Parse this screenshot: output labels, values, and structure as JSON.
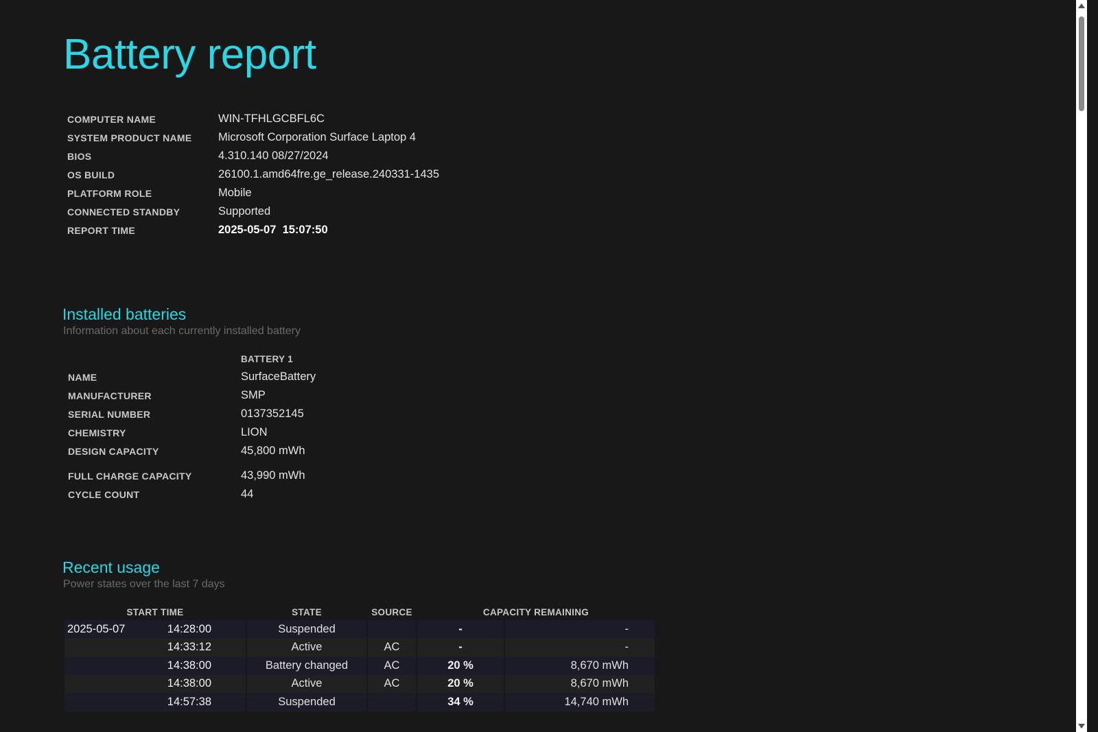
{
  "title": "Battery report",
  "system_info": [
    {
      "label": "COMPUTER NAME",
      "value": "WIN-TFHLGCBFL6C"
    },
    {
      "label": "SYSTEM PRODUCT NAME",
      "value": "Microsoft Corporation Surface Laptop 4"
    },
    {
      "label": "BIOS",
      "value": "4.310.140 08/27/2024"
    },
    {
      "label": "OS BUILD",
      "value": "26100.1.amd64fre.ge_release.240331-1435"
    },
    {
      "label": "PLATFORM ROLE",
      "value": "Mobile"
    },
    {
      "label": "CONNECTED STANDBY",
      "value": "Supported"
    },
    {
      "label": "REPORT TIME",
      "value": "2025-05-07  15:07:50"
    }
  ],
  "installed_batteries": {
    "title": "Installed batteries",
    "subtitle": "Information about each currently installed battery",
    "column_header": "BATTERY 1",
    "rows": [
      {
        "label": "NAME",
        "value": "SurfaceBattery"
      },
      {
        "label": "MANUFACTURER",
        "value": "SMP"
      },
      {
        "label": "SERIAL NUMBER",
        "value": "0137352145"
      },
      {
        "label": "CHEMISTRY",
        "value": "LION"
      },
      {
        "label": "DESIGN CAPACITY",
        "value": "45,800 mWh"
      },
      {
        "label": "FULL CHARGE CAPACITY",
        "value": "43,990 mWh"
      },
      {
        "label": "CYCLE COUNT",
        "value": "44"
      }
    ]
  },
  "recent_usage": {
    "title": "Recent usage",
    "subtitle": "Power states over the last 7 days",
    "headers": {
      "start_time": "START TIME",
      "state": "STATE",
      "source": "SOURCE",
      "capacity_remaining": "CAPACITY REMAINING"
    },
    "rows": [
      {
        "date": "2025-05-07",
        "time": "14:28:00",
        "state": "Suspended",
        "source": "",
        "percent": "-",
        "mwh": "-"
      },
      {
        "date": "",
        "time": "14:33:12",
        "state": "Active",
        "source": "AC",
        "percent": "-",
        "mwh": "-"
      },
      {
        "date": "",
        "time": "14:38:00",
        "state": "Battery changed",
        "source": "AC",
        "percent": "20 %",
        "mwh": "8,670 mWh"
      },
      {
        "date": "",
        "time": "14:38:00",
        "state": "Active",
        "source": "AC",
        "percent": "20 %",
        "mwh": "8,670 mWh"
      },
      {
        "date": "",
        "time": "14:57:38",
        "state": "Suspended",
        "source": "",
        "percent": "34 %",
        "mwh": "14,740 mWh"
      }
    ]
  },
  "colors": {
    "background": "#181818",
    "accent": "#2ed6e4",
    "subtitle": "#6a6a6a"
  }
}
